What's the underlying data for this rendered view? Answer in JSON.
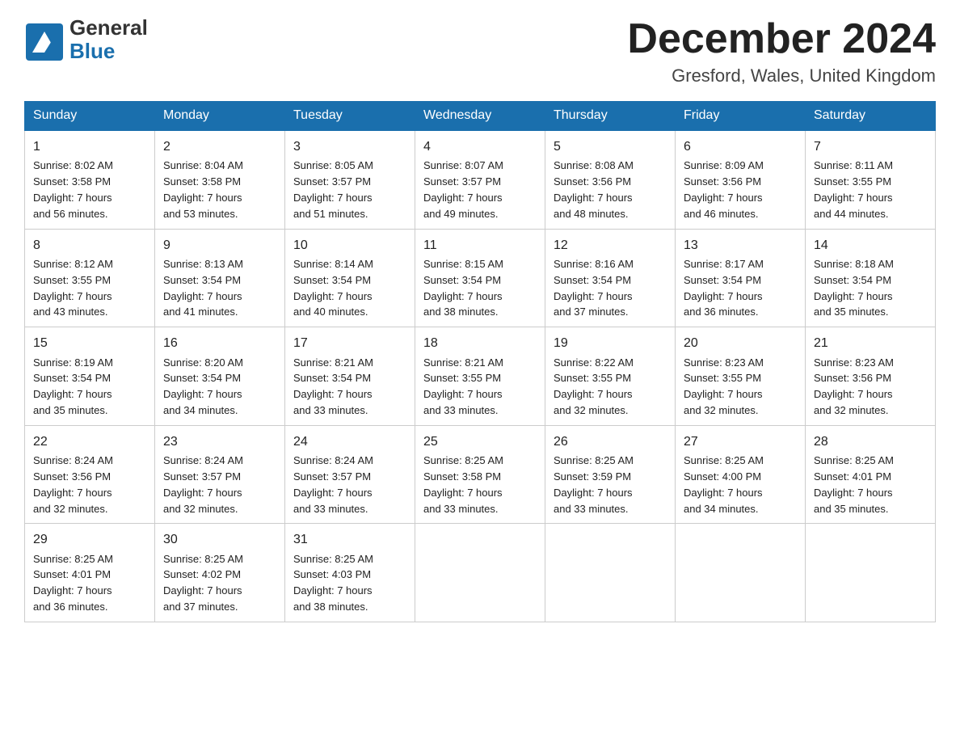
{
  "header": {
    "logo_general": "General",
    "logo_blue": "Blue",
    "month_title": "December 2024",
    "location": "Gresford, Wales, United Kingdom"
  },
  "days_of_week": [
    "Sunday",
    "Monday",
    "Tuesday",
    "Wednesday",
    "Thursday",
    "Friday",
    "Saturday"
  ],
  "weeks": [
    [
      {
        "day": "1",
        "sunrise": "Sunrise: 8:02 AM",
        "sunset": "Sunset: 3:58 PM",
        "daylight": "Daylight: 7 hours",
        "minutes": "and 56 minutes."
      },
      {
        "day": "2",
        "sunrise": "Sunrise: 8:04 AM",
        "sunset": "Sunset: 3:58 PM",
        "daylight": "Daylight: 7 hours",
        "minutes": "and 53 minutes."
      },
      {
        "day": "3",
        "sunrise": "Sunrise: 8:05 AM",
        "sunset": "Sunset: 3:57 PM",
        "daylight": "Daylight: 7 hours",
        "minutes": "and 51 minutes."
      },
      {
        "day": "4",
        "sunrise": "Sunrise: 8:07 AM",
        "sunset": "Sunset: 3:57 PM",
        "daylight": "Daylight: 7 hours",
        "minutes": "and 49 minutes."
      },
      {
        "day": "5",
        "sunrise": "Sunrise: 8:08 AM",
        "sunset": "Sunset: 3:56 PM",
        "daylight": "Daylight: 7 hours",
        "minutes": "and 48 minutes."
      },
      {
        "day": "6",
        "sunrise": "Sunrise: 8:09 AM",
        "sunset": "Sunset: 3:56 PM",
        "daylight": "Daylight: 7 hours",
        "minutes": "and 46 minutes."
      },
      {
        "day": "7",
        "sunrise": "Sunrise: 8:11 AM",
        "sunset": "Sunset: 3:55 PM",
        "daylight": "Daylight: 7 hours",
        "minutes": "and 44 minutes."
      }
    ],
    [
      {
        "day": "8",
        "sunrise": "Sunrise: 8:12 AM",
        "sunset": "Sunset: 3:55 PM",
        "daylight": "Daylight: 7 hours",
        "minutes": "and 43 minutes."
      },
      {
        "day": "9",
        "sunrise": "Sunrise: 8:13 AM",
        "sunset": "Sunset: 3:54 PM",
        "daylight": "Daylight: 7 hours",
        "minutes": "and 41 minutes."
      },
      {
        "day": "10",
        "sunrise": "Sunrise: 8:14 AM",
        "sunset": "Sunset: 3:54 PM",
        "daylight": "Daylight: 7 hours",
        "minutes": "and 40 minutes."
      },
      {
        "day": "11",
        "sunrise": "Sunrise: 8:15 AM",
        "sunset": "Sunset: 3:54 PM",
        "daylight": "Daylight: 7 hours",
        "minutes": "and 38 minutes."
      },
      {
        "day": "12",
        "sunrise": "Sunrise: 8:16 AM",
        "sunset": "Sunset: 3:54 PM",
        "daylight": "Daylight: 7 hours",
        "minutes": "and 37 minutes."
      },
      {
        "day": "13",
        "sunrise": "Sunrise: 8:17 AM",
        "sunset": "Sunset: 3:54 PM",
        "daylight": "Daylight: 7 hours",
        "minutes": "and 36 minutes."
      },
      {
        "day": "14",
        "sunrise": "Sunrise: 8:18 AM",
        "sunset": "Sunset: 3:54 PM",
        "daylight": "Daylight: 7 hours",
        "minutes": "and 35 minutes."
      }
    ],
    [
      {
        "day": "15",
        "sunrise": "Sunrise: 8:19 AM",
        "sunset": "Sunset: 3:54 PM",
        "daylight": "Daylight: 7 hours",
        "minutes": "and 35 minutes."
      },
      {
        "day": "16",
        "sunrise": "Sunrise: 8:20 AM",
        "sunset": "Sunset: 3:54 PM",
        "daylight": "Daylight: 7 hours",
        "minutes": "and 34 minutes."
      },
      {
        "day": "17",
        "sunrise": "Sunrise: 8:21 AM",
        "sunset": "Sunset: 3:54 PM",
        "daylight": "Daylight: 7 hours",
        "minutes": "and 33 minutes."
      },
      {
        "day": "18",
        "sunrise": "Sunrise: 8:21 AM",
        "sunset": "Sunset: 3:55 PM",
        "daylight": "Daylight: 7 hours",
        "minutes": "and 33 minutes."
      },
      {
        "day": "19",
        "sunrise": "Sunrise: 8:22 AM",
        "sunset": "Sunset: 3:55 PM",
        "daylight": "Daylight: 7 hours",
        "minutes": "and 32 minutes."
      },
      {
        "day": "20",
        "sunrise": "Sunrise: 8:23 AM",
        "sunset": "Sunset: 3:55 PM",
        "daylight": "Daylight: 7 hours",
        "minutes": "and 32 minutes."
      },
      {
        "day": "21",
        "sunrise": "Sunrise: 8:23 AM",
        "sunset": "Sunset: 3:56 PM",
        "daylight": "Daylight: 7 hours",
        "minutes": "and 32 minutes."
      }
    ],
    [
      {
        "day": "22",
        "sunrise": "Sunrise: 8:24 AM",
        "sunset": "Sunset: 3:56 PM",
        "daylight": "Daylight: 7 hours",
        "minutes": "and 32 minutes."
      },
      {
        "day": "23",
        "sunrise": "Sunrise: 8:24 AM",
        "sunset": "Sunset: 3:57 PM",
        "daylight": "Daylight: 7 hours",
        "minutes": "and 32 minutes."
      },
      {
        "day": "24",
        "sunrise": "Sunrise: 8:24 AM",
        "sunset": "Sunset: 3:57 PM",
        "daylight": "Daylight: 7 hours",
        "minutes": "and 33 minutes."
      },
      {
        "day": "25",
        "sunrise": "Sunrise: 8:25 AM",
        "sunset": "Sunset: 3:58 PM",
        "daylight": "Daylight: 7 hours",
        "minutes": "and 33 minutes."
      },
      {
        "day": "26",
        "sunrise": "Sunrise: 8:25 AM",
        "sunset": "Sunset: 3:59 PM",
        "daylight": "Daylight: 7 hours",
        "minutes": "and 33 minutes."
      },
      {
        "day": "27",
        "sunrise": "Sunrise: 8:25 AM",
        "sunset": "Sunset: 4:00 PM",
        "daylight": "Daylight: 7 hours",
        "minutes": "and 34 minutes."
      },
      {
        "day": "28",
        "sunrise": "Sunrise: 8:25 AM",
        "sunset": "Sunset: 4:01 PM",
        "daylight": "Daylight: 7 hours",
        "minutes": "and 35 minutes."
      }
    ],
    [
      {
        "day": "29",
        "sunrise": "Sunrise: 8:25 AM",
        "sunset": "Sunset: 4:01 PM",
        "daylight": "Daylight: 7 hours",
        "minutes": "and 36 minutes."
      },
      {
        "day": "30",
        "sunrise": "Sunrise: 8:25 AM",
        "sunset": "Sunset: 4:02 PM",
        "daylight": "Daylight: 7 hours",
        "minutes": "and 37 minutes."
      },
      {
        "day": "31",
        "sunrise": "Sunrise: 8:25 AM",
        "sunset": "Sunset: 4:03 PM",
        "daylight": "Daylight: 7 hours",
        "minutes": "and 38 minutes."
      },
      null,
      null,
      null,
      null
    ]
  ]
}
